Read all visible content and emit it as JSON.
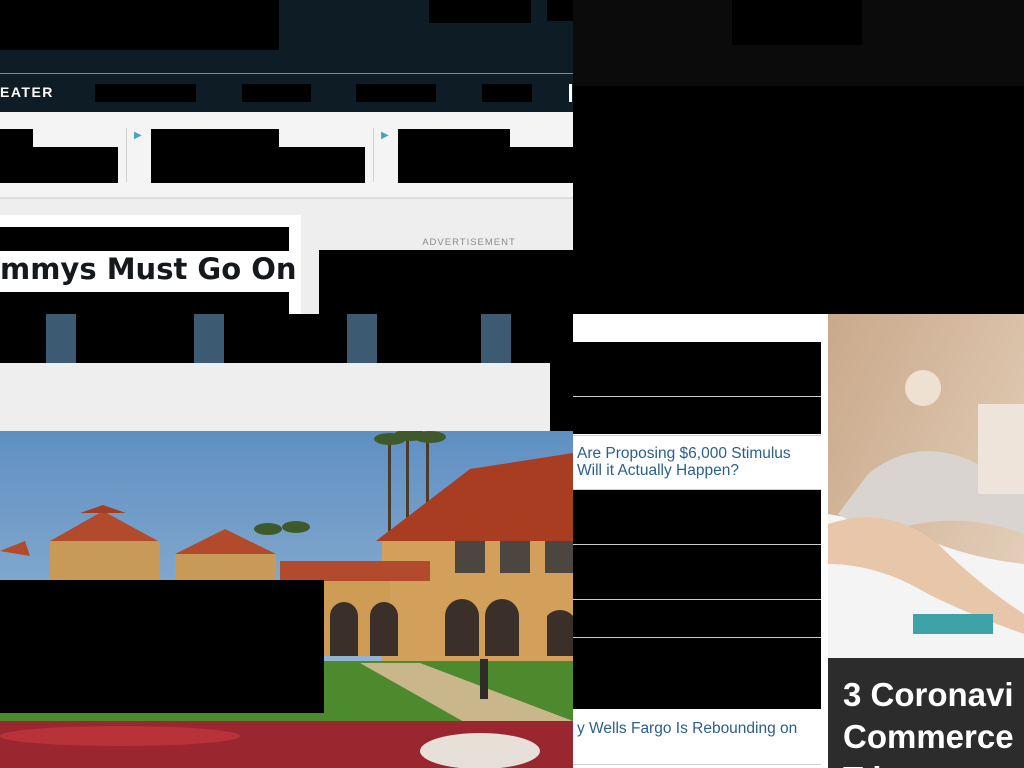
{
  "site": {
    "nav": {
      "section_label": "EATER"
    },
    "advertisement_label": "ADVERTISEMENT",
    "article": {
      "headline": "mmys Must Go On"
    }
  },
  "recommended": {
    "links": [
      {
        "line1": "Are Proposing $6,000 Stimulus",
        "line2": "Will it Actually Happen?"
      },
      {
        "line1": "y Wells Fargo Is Rebounding on",
        "line2": ""
      }
    ]
  },
  "promo_tile": {
    "caption_line1": "3 Coronavi",
    "caption_line2": "Commerce",
    "caption_line3": "T      l  t   "
  },
  "colors": {
    "header_navy": "#0e1c26",
    "link_blue": "#2a5f8e",
    "accent_teal": "#4aa6b8"
  }
}
